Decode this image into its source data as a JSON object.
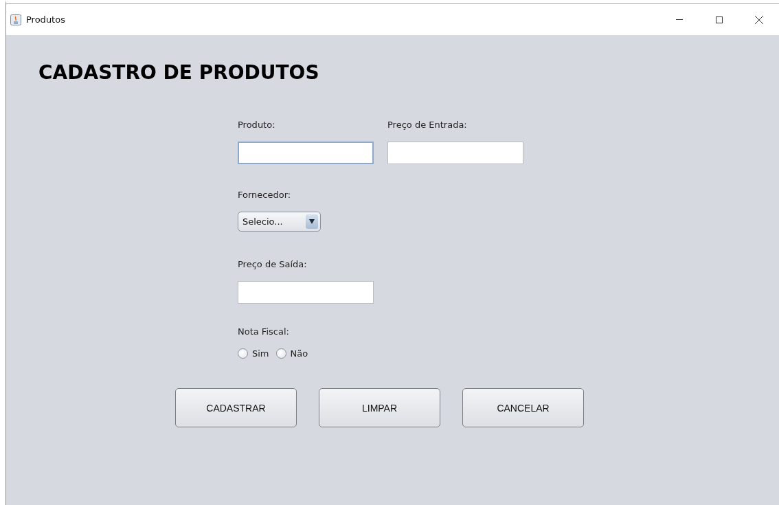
{
  "window": {
    "title": "Produtos"
  },
  "heading": "CADASTRO DE PRODUTOS",
  "fields": {
    "produto": {
      "label": "Produto:",
      "focused": true
    },
    "preco_entrada": {
      "label": "Preço de Entrada:",
      "focused": false
    },
    "fornecedor": {
      "label": "Fornecedor:",
      "value": "Selecio..."
    },
    "preco_saida": {
      "label": "Preço de Saída:",
      "focused": false
    },
    "nota_fiscal": {
      "label": "Nota Fiscal:",
      "options": [
        {
          "label": "Sim",
          "selected": false
        },
        {
          "label": "Não",
          "selected": false
        }
      ]
    }
  },
  "buttons": [
    "CADASTRAR",
    "LIMPAR",
    "CANCELAR"
  ]
}
